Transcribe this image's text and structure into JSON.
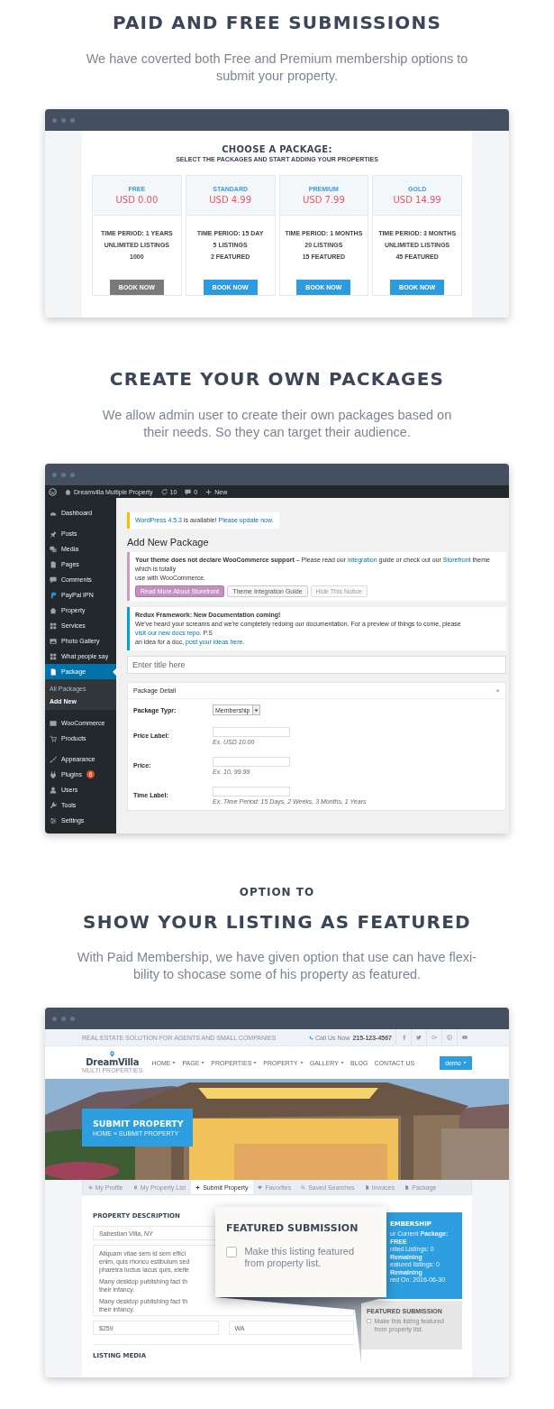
{
  "sections": [
    {
      "kind": "packages",
      "title": "PAID AND FREE SUBMISSIONS",
      "text": "We have coverted both Free and Premium membership options to submit your property.",
      "packages": {
        "title": "CHOOSE A PACKAGE:",
        "subtitle": "SELECT THE PACKAGES AND START ADDING YOUR PROPERTIES",
        "plans": [
          {
            "name": "FREE",
            "price": "USD 0.00",
            "features": [
              "TIME PERIOD: 1 YEARS",
              "UNLIMITED LISTINGS",
              "1000"
            ],
            "button": "BOOK NOW",
            "disabled": true
          },
          {
            "name": "STANDARD",
            "price": "USD 4.99",
            "features": [
              "TIME PERIOD: 15 DAY",
              "5 LISTINGS",
              "2 FEATURED"
            ],
            "button": "BOOK NOW",
            "disabled": false
          },
          {
            "name": "PREMIUM",
            "price": "USD 7.99",
            "features": [
              "TIME PERIOD: 1 MONTHS",
              "20 LISTINGS",
              "15 FEATURED"
            ],
            "button": "BOOK NOW",
            "disabled": false
          },
          {
            "name": "GOLD",
            "price": "USD 14.99",
            "features": [
              "TIME PERIOD: 3 MONTHS",
              "UNLIMITED LISTINGS",
              "45 FEATURED"
            ],
            "button": "BOOK NOW",
            "disabled": false
          }
        ]
      }
    },
    {
      "kind": "admin",
      "title": "CREATE YOUR OWN PACKAGES",
      "text": "We allow admin user to create their own packages based on their needs. So they can target their audience.",
      "admin": {
        "admin_bar": {
          "site": "Dreamvilla Multiple Property",
          "updates": "10",
          "comments": "0",
          "new": "New"
        },
        "sidebar": [
          {
            "items": [
              {
                "label": "Dashboard",
                "selected": false
              }
            ]
          },
          {
            "items": [
              {
                "label": "Posts",
                "selected": false
              },
              {
                "label": "Media",
                "selected": false
              },
              {
                "label": "Pages",
                "selected": false
              },
              {
                "label": "Comments",
                "selected": false
              },
              {
                "label": "PayPal IPN",
                "selected": false
              },
              {
                "label": "Property",
                "selected": false
              },
              {
                "label": "Services",
                "selected": false
              },
              {
                "label": "Photo Gallery",
                "selected": false
              },
              {
                "label": "What people say",
                "selected": false
              },
              {
                "label": "Package",
                "selected": true,
                "children": [
                  {
                    "label": "All Packages",
                    "selected": false
                  },
                  {
                    "label": "Add New",
                    "selected": true
                  }
                ]
              }
            ]
          },
          {
            "items": [
              {
                "label": "WooCommerce",
                "selected": false
              },
              {
                "label": "Products",
                "selected": false
              }
            ]
          },
          {
            "items": [
              {
                "label": "Appearance",
                "selected": false
              },
              {
                "label": "Plugins",
                "selected": false,
                "badge": "6"
              },
              {
                "label": "Users",
                "selected": false
              },
              {
                "label": "Tools",
                "selected": false
              },
              {
                "label": "Settings",
                "selected": false
              }
            ]
          }
        ],
        "update_notice": {
          "kind": "update",
          "lines": [
            [
              {
                "text": "WordPress 4.5.3",
                "kind": "link"
              },
              {
                "text": " is available! ",
                "kind": "plain"
              },
              {
                "text": "Please update now.",
                "kind": "link"
              }
            ]
          ]
        },
        "page_title": "Add New Package",
        "notices": [
          {
            "kind": "woo",
            "lines": [
              [
                {
                  "text": "Your theme does not declare WooCommerce support",
                  "kind": "bold"
                },
                {
                  "text": " – Please read our ",
                  "kind": "plain"
                },
                {
                  "text": "integration",
                  "kind": "link"
                },
                {
                  "text": " guide or check out our ",
                  "kind": "plain"
                },
                {
                  "text": "Storefront",
                  "kind": "link"
                },
                {
                  "text": " theme which is totally",
                  "kind": "plain"
                }
              ],
              [
                {
                  "text": "use with WooCommerce.",
                  "kind": "plain"
                }
              ]
            ],
            "buttons": [
              {
                "label": "Read More About Storefront",
                "kind": "primary",
                "disabled": false
              },
              {
                "label": "Theme Integration Guide",
                "kind": "secondary",
                "disabled": false
              },
              {
                "label": "Hide This Notice",
                "kind": "secondary",
                "disabled": true
              }
            ]
          },
          {
            "kind": "info",
            "lines": [
              [
                {
                  "text": "Redux Framework: New Documentation coming!",
                  "kind": "bold"
                }
              ],
              [
                {
                  "text": "We've heard your screams and we're completely redoing our documentation. For a preview of things to come, please ",
                  "kind": "plain"
                },
                {
                  "text": "visit our new docs repo.",
                  "kind": "link"
                },
                {
                  "text": " P.S",
                  "kind": "plain"
                }
              ],
              [
                {
                  "text": "an idea for a doc, ",
                  "kind": "plain"
                },
                {
                  "text": "post your ideas here.",
                  "kind": "link"
                }
              ]
            ]
          }
        ],
        "title_field": {
          "placeholder": "Enter title here"
        },
        "metabox": {
          "title": "Package Detail",
          "expanded": true,
          "fields": [
            {
              "label": "Package Typr:",
              "kind": "select",
              "value": "Membership"
            },
            {
              "label": "Price Label:",
              "kind": "text",
              "hint": "Ex. USD 10.00"
            },
            {
              "label": "Price:",
              "kind": "text",
              "hint": "Ex. 10, 99.99"
            },
            {
              "label": "Time Label:",
              "kind": "text",
              "hint": "Ex. Time Period: 15 Days, 2 Weeks, 3 Months, 1 Years"
            }
          ]
        }
      }
    },
    {
      "kind": "website",
      "kicker": "OPTION TO",
      "title": "SHOW YOUR LISTING AS FEATURED",
      "text": "With Paid Membership, we have given option that use can have flexi-bility to shocase some of his property as featured.",
      "website": {
        "topbar": {
          "tagline": "REAL ESTATE SOLUTION FOR AGENTS AND SMALL COMPANIES",
          "call_label": "Call Us Now",
          "phone": "215-123-4567"
        },
        "logo": {
          "name": "DreamVilla",
          "tagline": "MULTI PROPERTIES"
        },
        "menu": [
          {
            "label": "HOME",
            "dropdown": true
          },
          {
            "label": "PAGE",
            "dropdown": true
          },
          {
            "label": "PROPERTIES",
            "dropdown": true
          },
          {
            "label": "PROPERTY",
            "dropdown": true
          },
          {
            "label": "GALLERY",
            "dropdown": true
          },
          {
            "label": "BLOG",
            "dropdown": false
          },
          {
            "label": "CONTACT US",
            "dropdown": false
          }
        ],
        "user_button": "demo",
        "hero": {
          "kind": "picture",
          "title": "SUBMIT PROPERTY",
          "breadcrumb": "HOME » SUBMIT PROPERTY"
        },
        "tabs": [
          {
            "label": "My Profile",
            "selected": false
          },
          {
            "label": "My Property List",
            "selected": false
          },
          {
            "label": "Submit Property",
            "selected": true
          },
          {
            "label": "Favorites",
            "selected": false
          },
          {
            "label": "Saved Searches",
            "selected": false
          },
          {
            "label": "Invoices",
            "selected": false
          },
          {
            "label": "Package",
            "selected": false
          }
        ],
        "form": {
          "heading": "PROPERTY DESCRIPTION",
          "title_value": "Sabestian Villa, NY",
          "description": [
            [
              "Aliquam vitae sem id sem effici",
              "enim, quis rhoncu estibulum sed",
              "pharetra luctus lacus quis, eleife"
            ],
            [
              "Many desktop publishing fact th",
              "their infancy."
            ],
            [
              "Many desktop publishing fact th",
              "their infancy."
            ]
          ],
          "price_value": "$259",
          "state_value": "WA",
          "media_heading": "LISTING MEDIA"
        },
        "membership": {
          "title": "EMBERSHIP",
          "lines": [
            "ur Current **Package: FREE**",
            "nited Listings: 0 **Remaining**",
            "eatured listings: 0 **Remaining**",
            "red On: 2016-06-30"
          ]
        },
        "featured": {
          "title": "FEATURED SUBMISSION",
          "label": "Make this listing featured from property list.",
          "checked": false
        },
        "callout": {
          "title": "FEATURED SUBMISSION",
          "label": "Make this listing featured from property list.",
          "checked": false
        }
      }
    }
  ]
}
